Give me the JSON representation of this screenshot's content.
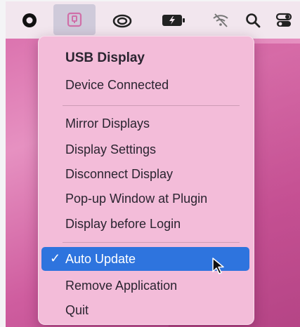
{
  "menubar": {
    "icons": [
      "record-icon",
      "usb-display-icon",
      "creative-cloud-icon",
      "battery-icon",
      "wifi-off-icon",
      "search-icon",
      "control-center-icon"
    ]
  },
  "menu": {
    "header_title": "USB Display",
    "header_status": "Device Connected",
    "items_group1": [
      "Mirror Displays",
      "Display Settings",
      "Disconnect Display",
      "Pop-up Window at Plugin",
      "Display before Login"
    ],
    "checked_item": "Auto Update",
    "check_mark": "✓",
    "items_group2": [
      "Remove Application",
      "Quit"
    ]
  },
  "colors": {
    "menu_bg": "#f3bcd9",
    "highlight": "#2e74de",
    "wallpaper": "#d86aa9"
  }
}
